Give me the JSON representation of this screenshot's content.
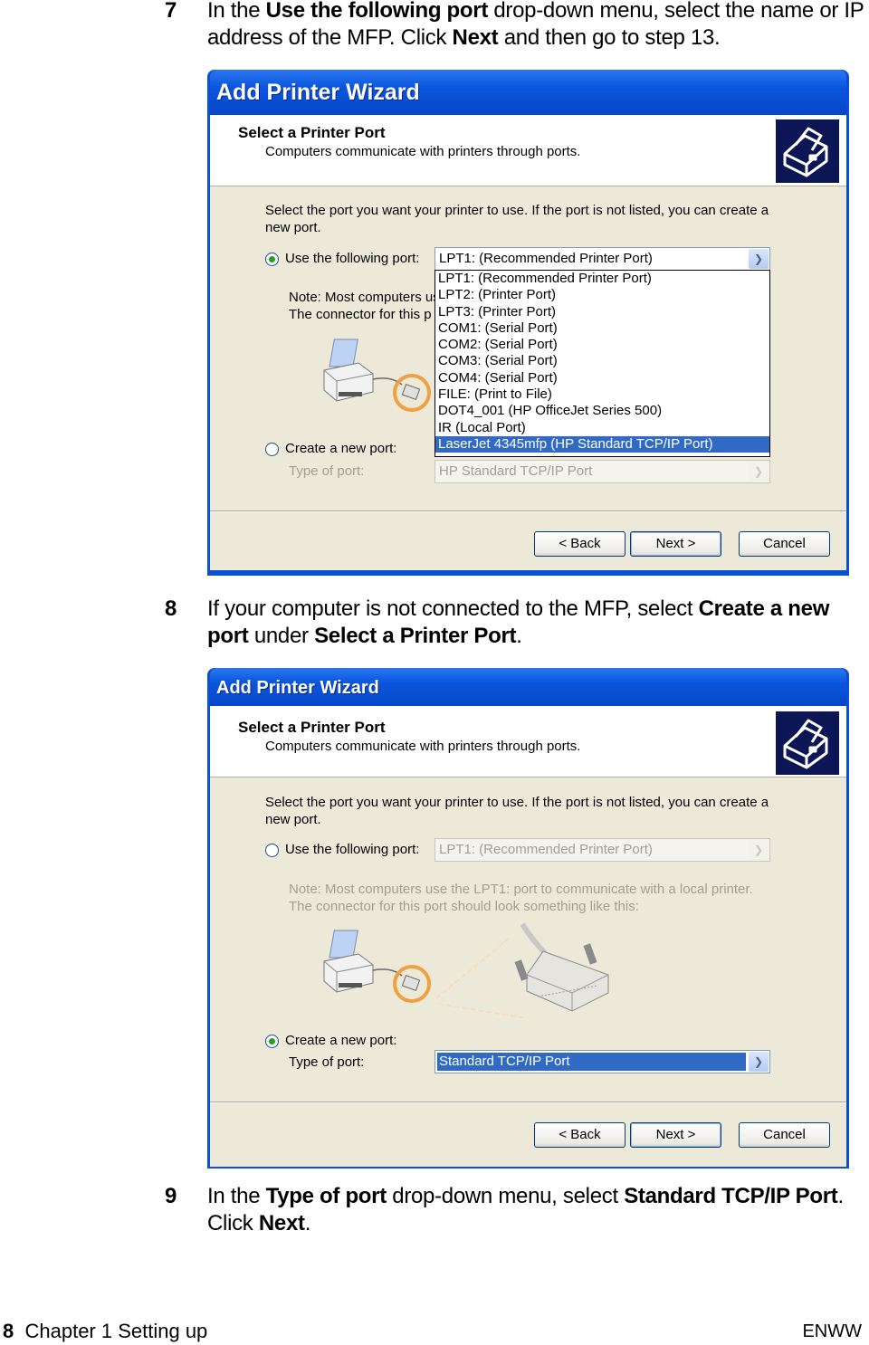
{
  "steps": [
    {
      "number": "7",
      "parts": [
        {
          "t": "In the ",
          "b": false
        },
        {
          "t": "Use the following port",
          "b": true
        },
        {
          "t": " drop-down menu, select the name or IP address of the MFP. Click ",
          "b": false
        },
        {
          "t": "Next",
          "b": true
        },
        {
          "t": " and then go to step 13.",
          "b": false
        }
      ]
    },
    {
      "number": "8",
      "parts": [
        {
          "t": "If your computer is not connected to the MFP, select ",
          "b": false
        },
        {
          "t": "Create a new port",
          "b": true
        },
        {
          "t": " under ",
          "b": false
        },
        {
          "t": "Select a Printer Port",
          "b": true
        },
        {
          "t": ".",
          "b": false
        }
      ]
    },
    {
      "number": "9",
      "parts": [
        {
          "t": "In the ",
          "b": false
        },
        {
          "t": "Type of port",
          "b": true
        },
        {
          "t": " drop-down menu, select ",
          "b": false
        },
        {
          "t": "Standard TCP/IP Port",
          "b": true
        },
        {
          "t": ". Click ",
          "b": false
        },
        {
          "t": "Next",
          "b": true
        },
        {
          "t": ".",
          "b": false
        }
      ]
    }
  ],
  "wizard1": {
    "title": "Add Printer Wizard",
    "header_title": "Select a Printer Port",
    "header_subtitle": "Computers communicate with printers through ports.",
    "instruction": "Select the port you want your printer to use.  If the port is not listed, you can create a new port.",
    "use_port_label": "Use the following port:",
    "use_port_selected": true,
    "use_port_value": "LPT1: (Recommended Printer Port)",
    "note_line1": "Note: Most computers us",
    "note_line2": "The connector for this p",
    "dropdown_options": [
      "LPT1: (Recommended Printer Port)",
      "LPT2: (Printer Port)",
      "LPT3: (Printer Port)",
      "COM1: (Serial Port)",
      "COM2: (Serial Port)",
      "COM3: (Serial Port)",
      "COM4: (Serial Port)",
      "FILE: (Print to File)",
      "DOT4_001 (HP OfficeJet Series 500)",
      "IR (Local Port)",
      "LaserJet 4345mfp (HP Standard TCP/IP Port)"
    ],
    "dropdown_selected_index": 10,
    "create_port_label": "Create a new port:",
    "create_port_selected": false,
    "type_of_port_label": "Type of port:",
    "type_of_port_value": "HP Standard TCP/IP Port",
    "buttons": {
      "back": "< Back",
      "next": "Next >",
      "cancel": "Cancel"
    }
  },
  "wizard2": {
    "title": "Add Printer Wizard",
    "header_title": "Select a Printer Port",
    "header_subtitle": "Computers communicate with printers through ports.",
    "instruction": "Select the port you want your printer to use.  If the port is not listed, you can create a new port.",
    "use_port_label": "Use the following port:",
    "use_port_selected": false,
    "use_port_value": "LPT1: (Recommended Printer Port)",
    "note_line1": "Note: Most computers use the LPT1: port to communicate with a local printer.",
    "note_line2": "The connector for this port should look something like this:",
    "create_port_label": "Create a new port:",
    "create_port_selected": true,
    "type_of_port_label": "Type of port:",
    "type_of_port_value": "Standard TCP/IP Port",
    "buttons": {
      "back": "< Back",
      "next": "Next >",
      "cancel": "Cancel"
    }
  },
  "footer": {
    "page_number": "8",
    "chapter": "Chapter 1 Setting up",
    "right": "ENWW"
  },
  "colors": {
    "titlebar": "#0a55dd",
    "selection": "#316ac5",
    "dialog_bg": "#ece9d8",
    "radio_dot": "#21a121",
    "highlight_ring": "#f0a040"
  }
}
